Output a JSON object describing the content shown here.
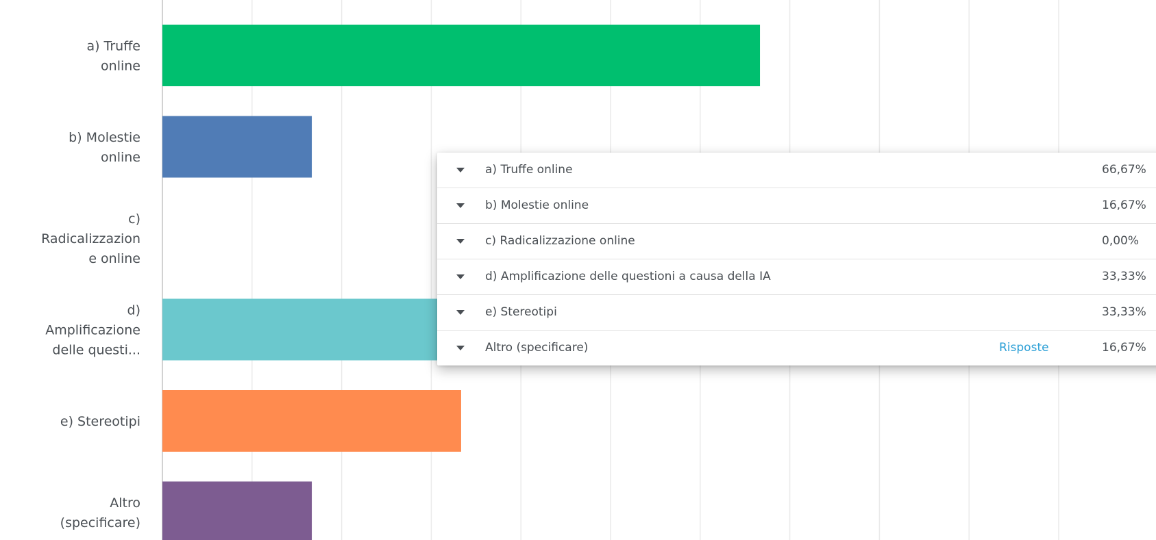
{
  "chart_data": {
    "type": "bar",
    "orientation": "horizontal",
    "categories": [
      "a) Truffe online",
      "b) Molestie online",
      "c) Radicalizzazione online",
      "d) Amplificazione delle questioni a causa della IA",
      "e) Stereotipi",
      "Altro (specificare)"
    ],
    "category_labels_displayed": [
      [
        "a) Truffe",
        "online"
      ],
      [
        "b) Molestie",
        "online"
      ],
      [
        "c)",
        "Radicalizzazion",
        "e online"
      ],
      [
        "d)",
        "Amplificazione",
        "delle questi..."
      ],
      [
        "e) Stereotipi"
      ],
      [
        "Altro",
        "(specificare)"
      ]
    ],
    "values": [
      66.67,
      16.67,
      0.0,
      33.33,
      33.33,
      16.67
    ],
    "units": "%",
    "xlim": [
      0,
      100
    ],
    "grid": true,
    "colors": [
      "#00bf6f",
      "#507cb6",
      "#6bc8cd",
      "#6bc8cd",
      "#ff8b4f",
      "#7d5c91"
    ],
    "title": "",
    "xlabel": "",
    "ylabel": ""
  },
  "results_panel": {
    "rows": [
      {
        "label": "a) Truffe online",
        "value": "66,67%",
        "link": ""
      },
      {
        "label": "b) Molestie online",
        "value": "16,67%",
        "link": ""
      },
      {
        "label": "c) Radicalizzazione online",
        "value": "0,00%",
        "link": ""
      },
      {
        "label": "d) Amplificazione delle questioni a causa della IA",
        "value": "33,33%",
        "link": ""
      },
      {
        "label": "e) Stereotipi",
        "value": "33,33%",
        "link": ""
      },
      {
        "label": "Altro (specificare)",
        "value": "16,67%",
        "link": "Risposte"
      }
    ],
    "icon": "caret-down-icon",
    "link_color": "#2b9fd6"
  }
}
